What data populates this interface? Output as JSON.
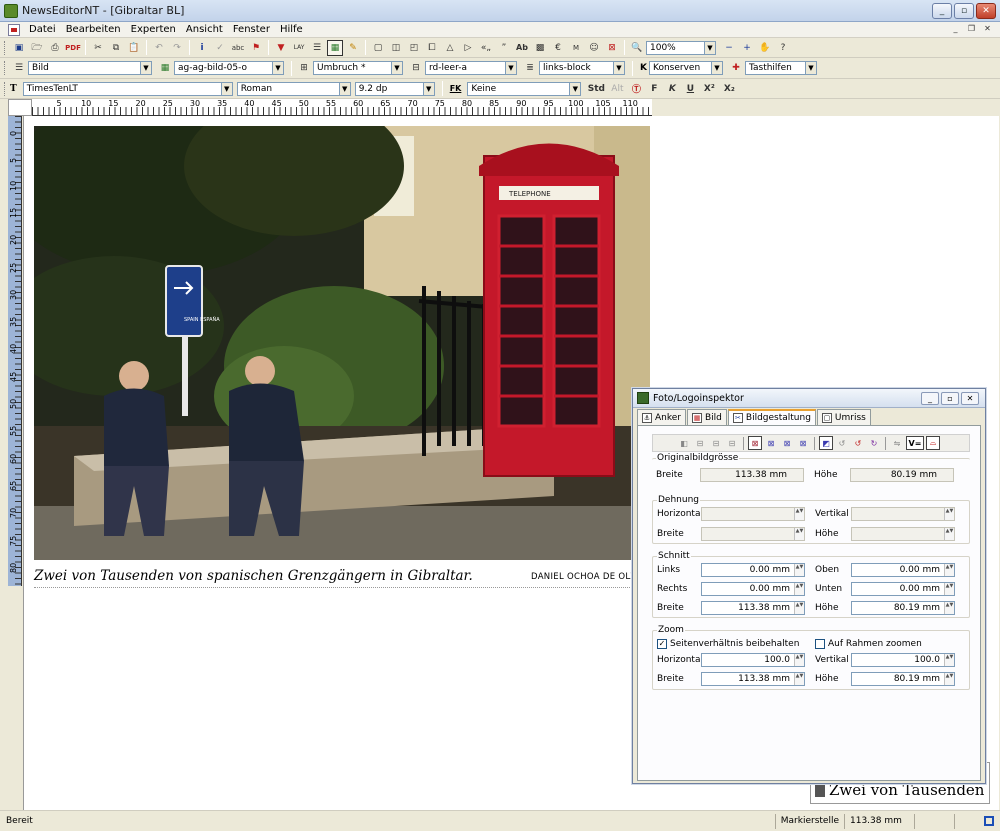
{
  "window": {
    "title": "NewsEditorNT - [Gibraltar BL]"
  },
  "menu": {
    "items": [
      "Datei",
      "Bearbeiten",
      "Experten",
      "Ansicht",
      "Fenster",
      "Hilfe"
    ]
  },
  "toolbar1": {
    "zoom": "100%"
  },
  "toolbar2": {
    "frame_type": "Bild",
    "frame_name": "ag-ag-bild-05-o",
    "wrap": "Umbruch *",
    "frame_style": "rd-leer-a",
    "align": "links-block",
    "conserve_label": "K",
    "conserve": "Konserven",
    "helpers": "Tasthilfen"
  },
  "toolbar3": {
    "font_label": "T",
    "font": "TimesTenLT",
    "style": "Roman",
    "size": "9.2 dp",
    "fk_label": "FK",
    "fk_value": "Keine",
    "std": "Std",
    "alt": "Alt",
    "bold": "F",
    "italic": "K",
    "underline": "U",
    "superscript": "X²",
    "subscript": "X₂"
  },
  "ruler_h": [
    "5",
    "10",
    "15",
    "20",
    "25",
    "30",
    "35",
    "40",
    "45",
    "50",
    "55",
    "60",
    "65",
    "70",
    "75",
    "80",
    "85",
    "90",
    "95",
    "100",
    "105",
    "110",
    "11"
  ],
  "ruler_v": [
    "0",
    "5",
    "10",
    "15",
    "20",
    "25",
    "30",
    "35",
    "40",
    "45",
    "50",
    "55",
    "60",
    "65",
    "70",
    "75",
    "80"
  ],
  "document": {
    "sign_text": "SPAIN ESPAÑA",
    "booth_text": "TELEPHONE",
    "caption": "Zwei von Tausenden von spanischen Grenzgängern in Gibraltar.",
    "credit": "DANIEL OCHOA DE OLZA",
    "mini_frame_text": "Zwei von Tausenden vo"
  },
  "inspector": {
    "title": "Foto/Logoinspektor",
    "tabs": [
      "Anker",
      "Bild",
      "Bildgestaltung",
      "Umriss"
    ],
    "original": {
      "label": "Originalbildgrösse",
      "breite_label": "Breite",
      "breite": "113.38 mm",
      "hoehe_label": "Höhe",
      "hoehe": "80.19 mm"
    },
    "dehnung": {
      "label": "Dehnung",
      "horizontal_label": "Horizontal",
      "vertikal_label": "Vertikal",
      "breite_label": "Breite",
      "hoehe_label": "Höhe"
    },
    "schnitt": {
      "label": "Schnitt",
      "links_label": "Links",
      "links": "0.00 mm",
      "oben_label": "Oben",
      "oben": "0.00 mm",
      "rechts_label": "Rechts",
      "rechts": "0.00 mm",
      "unten_label": "Unten",
      "unten": "0.00 mm",
      "breite_label": "Breite",
      "breite": "113.38 mm",
      "hoehe_label": "Höhe",
      "hoehe": "80.19 mm"
    },
    "zoom": {
      "label": "Zoom",
      "keep_ratio_label": "Seitenverhältnis beibehalten",
      "keep_ratio": true,
      "fit_frame_label": "Auf Rahmen zoomen",
      "fit_frame": false,
      "horizontal_label": "Horizontal",
      "horizontal": "100.0",
      "vertikal_label": "Vertikal",
      "vertikal": "100.0",
      "breite_label": "Breite",
      "breite": "113.38 mm",
      "hoehe_label": "Höhe",
      "hoehe": "80.19 mm"
    }
  },
  "status": {
    "left": "Bereit",
    "marker": "Markierstelle",
    "value": "113.38 mm"
  },
  "colors": {
    "booth": "#c4182a",
    "accent": "#e8a030",
    "selection": "#1b4eb6"
  }
}
